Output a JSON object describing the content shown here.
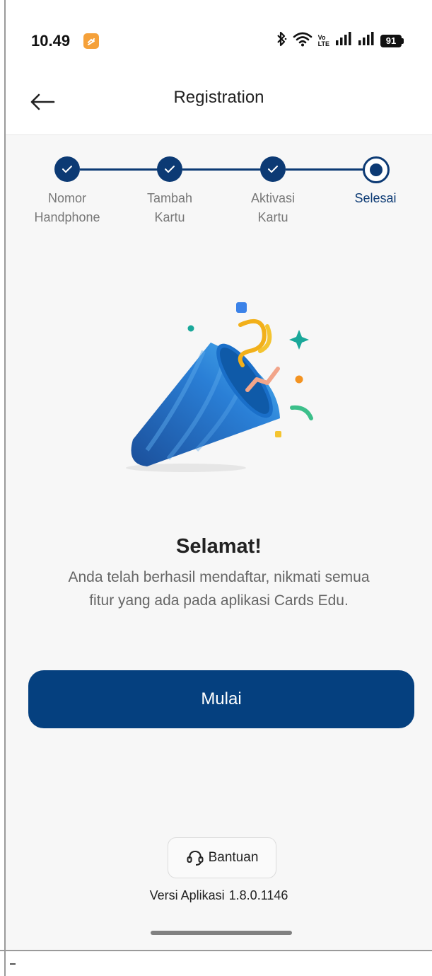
{
  "status_bar": {
    "time": "10.49",
    "battery": "91",
    "network_label_top": "Vo",
    "network_label_bottom": "LTE"
  },
  "header": {
    "title": "Registration"
  },
  "stepper": {
    "steps": [
      {
        "label_line1": "Nomor",
        "label_line2": "Handphone",
        "state": "done"
      },
      {
        "label_line1": "Tambah",
        "label_line2": "Kartu",
        "state": "done"
      },
      {
        "label_line1": "Aktivasi",
        "label_line2": "Kartu",
        "state": "done"
      },
      {
        "label_line1": "Selesai",
        "label_line2": "",
        "state": "current"
      }
    ]
  },
  "message": {
    "title": "Selamat!",
    "body": "Anda telah berhasil mendaftar, nikmati semua fitur yang ada pada aplikasi Cards Edu."
  },
  "actions": {
    "start_label": "Mulai",
    "help_label": "Bantuan"
  },
  "footer": {
    "version_label": "Versi Aplikasi",
    "version_number": "1.8.0.1146"
  },
  "colors": {
    "primary": "#05407f",
    "stepper": "#0c3a74",
    "background": "#f7f7f7"
  },
  "icons": [
    "back-arrow-icon",
    "bluetooth-icon",
    "wifi-icon",
    "signal-icon",
    "battery-icon",
    "check-icon",
    "headset-icon",
    "party-popper-icon"
  ]
}
